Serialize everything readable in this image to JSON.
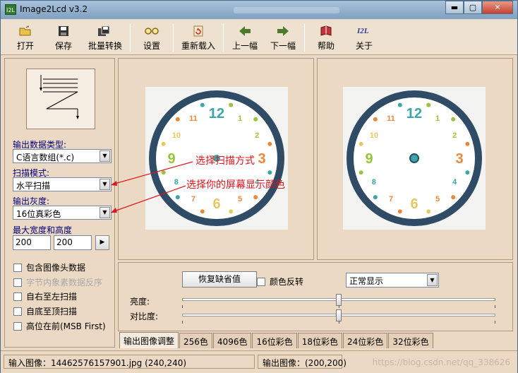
{
  "window": {
    "title": "Image2Lcd v3.2",
    "icon_text": "I2L",
    "minimize": "▬",
    "maximize": "▢",
    "close": "✕"
  },
  "toolbar": [
    {
      "id": "open",
      "label": "打开",
      "icon": "folder-open-icon"
    },
    {
      "id": "save",
      "label": "保存",
      "icon": "floppy-icon"
    },
    {
      "id": "batch",
      "label": "批量转换",
      "icon": "batch-icon"
    },
    {
      "id": "settings",
      "label": "设置",
      "icon": "glasses-icon"
    },
    {
      "id": "reload",
      "label": "重新载入",
      "icon": "reload-icon"
    },
    {
      "id": "prev",
      "label": "上一幅",
      "icon": "arrow-left-icon"
    },
    {
      "id": "next",
      "label": "下一幅",
      "icon": "arrow-right-icon"
    },
    {
      "id": "help",
      "label": "帮助",
      "icon": "help-book-icon"
    },
    {
      "id": "about",
      "label": "关于",
      "icon": "about-icon"
    }
  ],
  "left": {
    "output_type_label": "输出数据类型:",
    "output_type_value": "C语言数组(*.c)",
    "scan_mode_label": "扫描模式:",
    "scan_mode_value": "水平扫描",
    "gray_label": "输出灰度:",
    "gray_value": "16位真彩色",
    "size_label": "最大宽度和高度",
    "max_width": "200",
    "max_height": "200",
    "size_button": "▶",
    "checks": [
      {
        "label": "包含图像头数据",
        "disabled": false
      },
      {
        "label": "字节内象素数据反序",
        "disabled": true
      },
      {
        "label": "自右至左扫描",
        "disabled": false
      },
      {
        "label": "自底至顶扫描",
        "disabled": false
      },
      {
        "label": "高位在前(MSB First)",
        "disabled": false
      }
    ]
  },
  "annotations": {
    "scan_hint": "选择扫描方式",
    "color_hint": "选择你的屏幕显示颜色"
  },
  "clock": {
    "numbers": [
      "12",
      "1",
      "2",
      "3",
      "4",
      "5",
      "6",
      "7",
      "8",
      "9",
      "10",
      "11"
    ]
  },
  "bottom": {
    "restore_button": "恢复缺省值",
    "invert_label": "颜色反转",
    "display_mode": "正常显示",
    "brightness_label": "亮度:",
    "contrast_label": "对比度:",
    "brightness": 50,
    "contrast": 50
  },
  "tabs": [
    "输出图像调整",
    "256色",
    "4096色",
    "16位彩色",
    "18位彩色",
    "24位彩色",
    "32位彩色"
  ],
  "status": {
    "input": "输入图像：14462576157901.jpg (240,240)",
    "output": "输出图像：(200,200)",
    "watermark": "https://blog.csdn.net/qq_338626"
  },
  "colors": {
    "accent_red": "#e0141b",
    "clock_ring": "#2f4b66",
    "clock_teal": "#3aa7a6",
    "clock_orange": "#e8883a",
    "clock_yellow": "#e8c860",
    "clock_green": "#9ac33b"
  }
}
